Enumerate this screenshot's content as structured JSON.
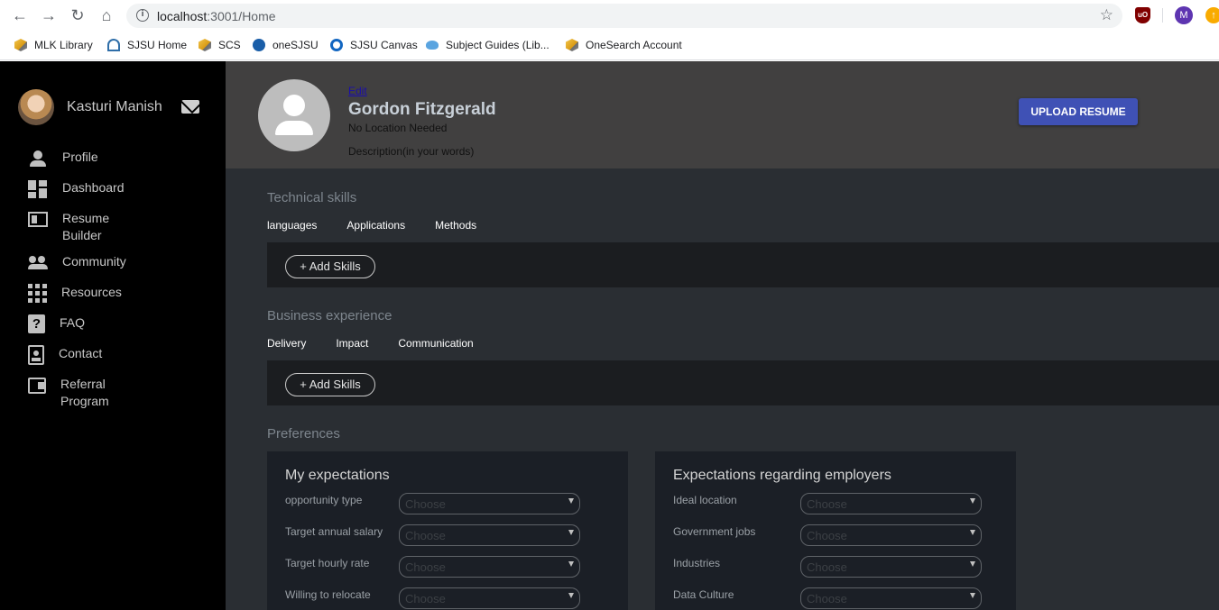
{
  "browser": {
    "url_host": "localhost",
    "url_rest": ":3001/Home",
    "profile_initial": "M",
    "ublock_badge": "uO",
    "bookmarks": [
      {
        "label": "MLK Library",
        "icon": "cube-icon"
      },
      {
        "label": "SJSU Home",
        "icon": "spartan-icon"
      },
      {
        "label": "SCS",
        "icon": "cube-icon"
      },
      {
        "label": "oneSJSU",
        "icon": "onesjsu-icon"
      },
      {
        "label": "SJSU Canvas",
        "icon": "canvas-icon"
      },
      {
        "label": "Subject Guides (Lib...",
        "icon": "cloud-icon"
      },
      {
        "label": "OneSearch Account",
        "icon": "cube-icon"
      }
    ]
  },
  "sidebar": {
    "user_name": "Kasturi Manish",
    "items": [
      {
        "label": "Profile",
        "icon": "person-icon"
      },
      {
        "label": "Dashboard",
        "icon": "dashboard-icon"
      },
      {
        "label": "Resume Builder",
        "icon": "resume-icon"
      },
      {
        "label": "Community",
        "icon": "people-icon"
      },
      {
        "label": "Resources",
        "icon": "apps-icon"
      },
      {
        "label": "FAQ",
        "icon": "question-icon"
      },
      {
        "label": "Contact",
        "icon": "contact-icon"
      },
      {
        "label": "Referral Program",
        "icon": "wallet-icon"
      }
    ]
  },
  "profile": {
    "edit_label": "Edit",
    "name": "Gordon Fitzgerald",
    "location": "No Location Needed",
    "description": "Description(in your words)",
    "upload_label": "UPLOAD RESUME"
  },
  "technical": {
    "title": "Technical skills",
    "tabs": [
      "languages",
      "Applications",
      "Methods"
    ],
    "add_label": "+ Add Skills"
  },
  "business": {
    "title": "Business experience",
    "tabs": [
      "Delivery",
      "Impact",
      "Communication"
    ],
    "add_label": "+ Add Skills"
  },
  "preferences": {
    "title": "Preferences",
    "my_expectations": {
      "title": "My expectations",
      "rows": [
        {
          "label": "opportunity type",
          "value": "Choose"
        },
        {
          "label": "Target annual salary",
          "value": "Choose"
        },
        {
          "label": "Target hourly rate",
          "value": "Choose"
        },
        {
          "label": "Willing to relocate",
          "value": "Choose"
        }
      ]
    },
    "employer_expectations": {
      "title": "Expectations regarding employers",
      "rows": [
        {
          "label": "Ideal location",
          "value": "Choose"
        },
        {
          "label": "Government jobs",
          "value": "Choose"
        },
        {
          "label": "Industries",
          "value": "Choose"
        },
        {
          "label": "Data Culture",
          "value": "Choose"
        }
      ]
    }
  }
}
